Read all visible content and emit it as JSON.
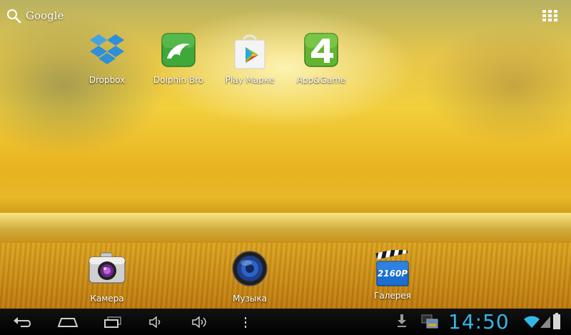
{
  "search": {
    "label": "Google"
  },
  "desktop": {
    "top_row": [
      {
        "label": "Dropbox",
        "icon": "dropbox-icon"
      },
      {
        "label": "Dolphin Bro",
        "icon": "dolphin-browser-icon"
      },
      {
        "label": "Play Марке",
        "icon": "play-market-icon"
      },
      {
        "label": "App&Game",
        "icon": "app-game-icon"
      }
    ],
    "dock": [
      {
        "label": "Камера",
        "icon": "camera-icon"
      },
      {
        "label": "Музыка",
        "icon": "music-icon"
      },
      {
        "label": "Галерея",
        "icon": "gallery-icon"
      }
    ]
  },
  "gallery_badge": "2160P",
  "system_bar": {
    "time": "14:50",
    "clock_color": "#35b5e5"
  }
}
